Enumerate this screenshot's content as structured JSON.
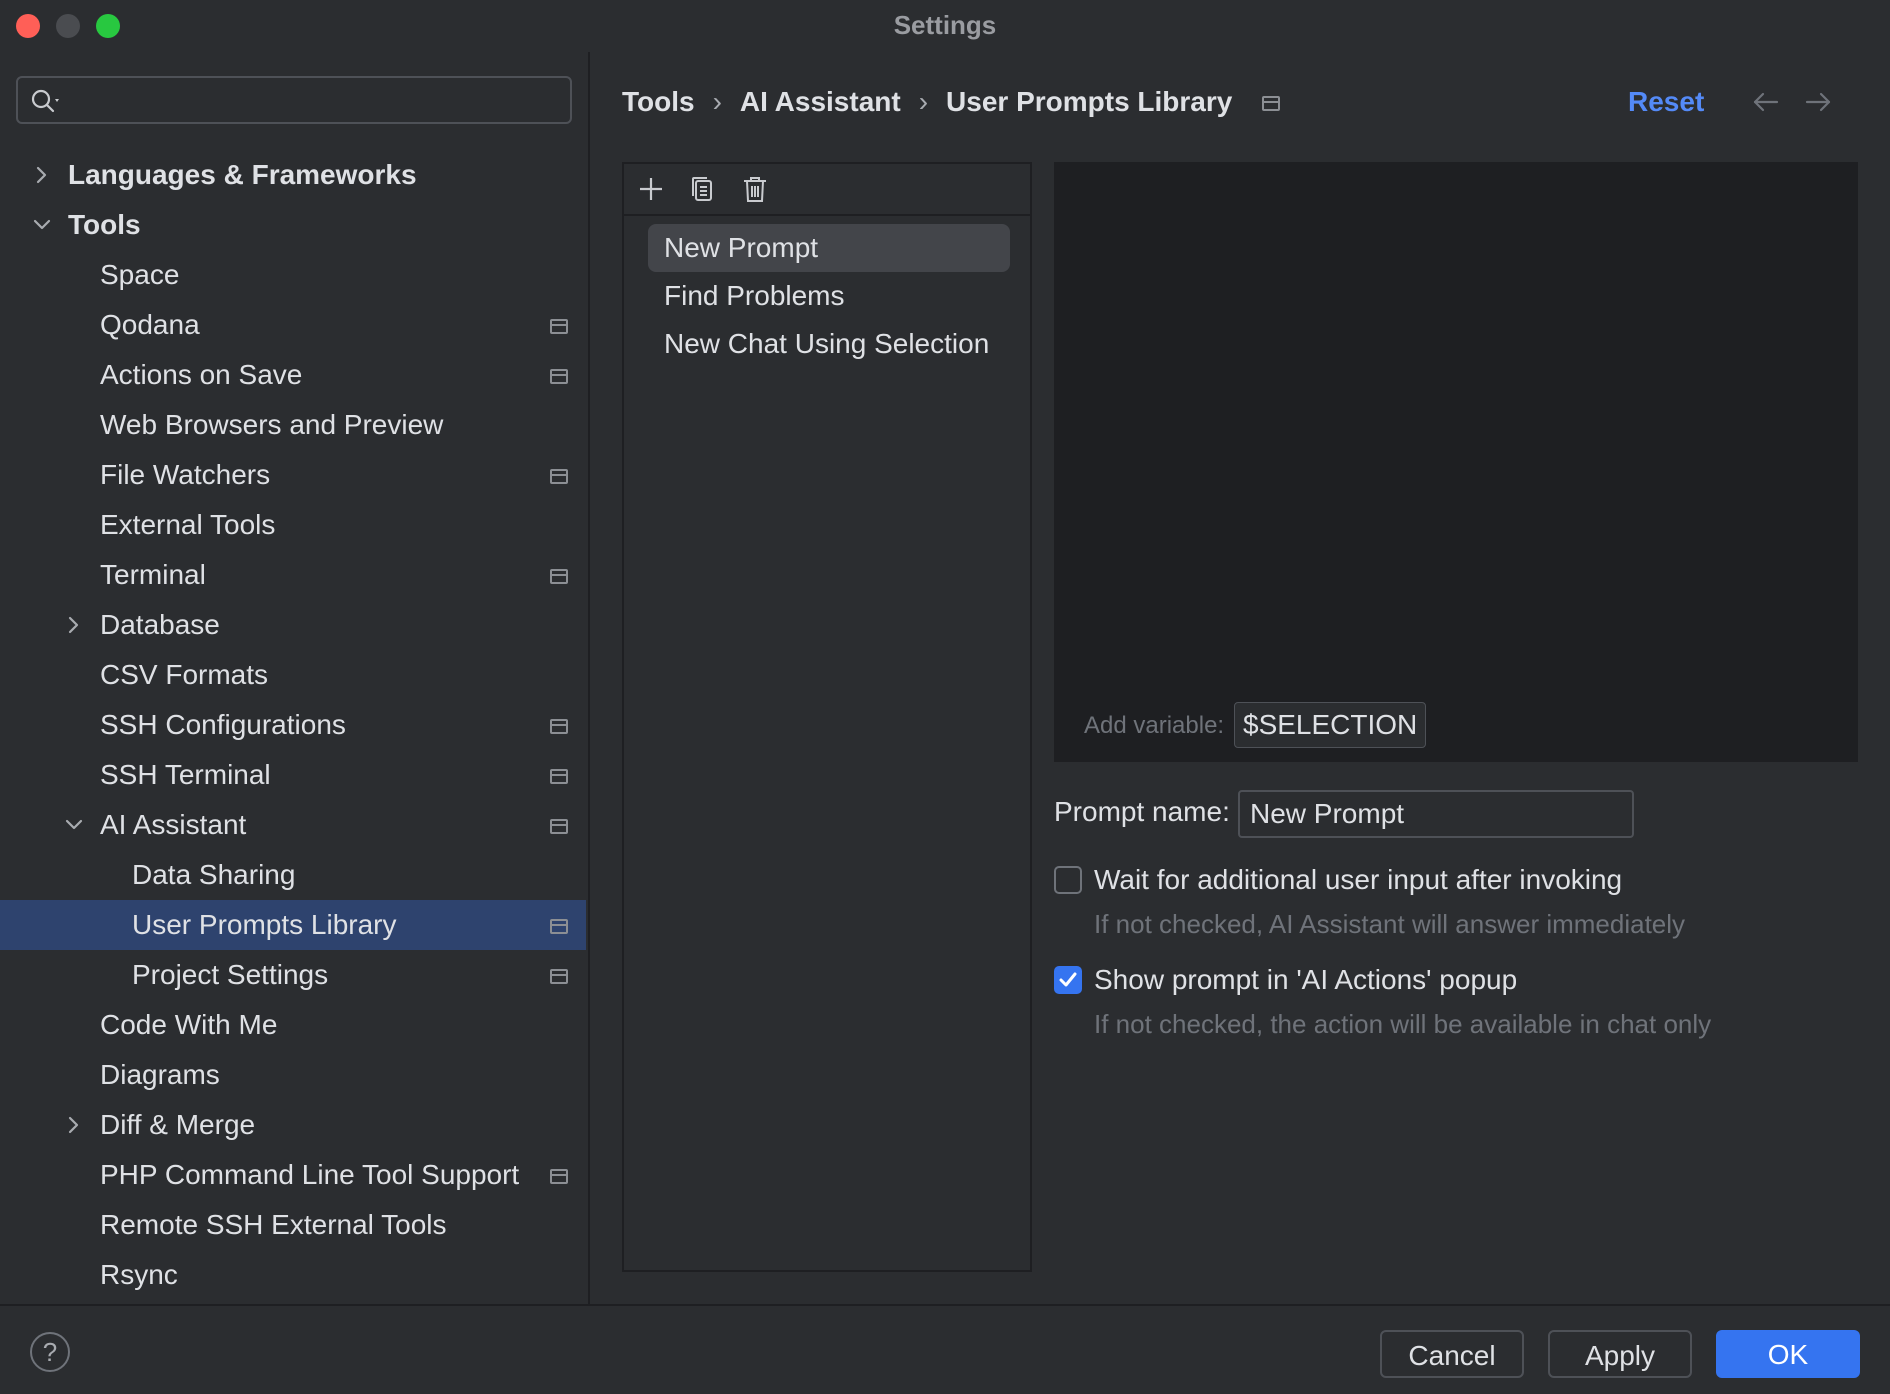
{
  "window": {
    "title": "Settings"
  },
  "search": {
    "placeholder": "",
    "value": ""
  },
  "sidebar": {
    "items": [
      {
        "label": "Languages & Frameworks",
        "bold": true,
        "indent": 0,
        "arrow": "right",
        "pinned": false,
        "selected": false
      },
      {
        "label": "Tools",
        "bold": true,
        "indent": 0,
        "arrow": "down",
        "pinned": false,
        "selected": false
      },
      {
        "label": "Space",
        "bold": false,
        "indent": 1,
        "arrow": "",
        "pinned": false,
        "selected": false
      },
      {
        "label": "Qodana",
        "bold": false,
        "indent": 1,
        "arrow": "",
        "pinned": true,
        "selected": false
      },
      {
        "label": "Actions on Save",
        "bold": false,
        "indent": 1,
        "arrow": "",
        "pinned": true,
        "selected": false
      },
      {
        "label": "Web Browsers and Preview",
        "bold": false,
        "indent": 1,
        "arrow": "",
        "pinned": false,
        "selected": false
      },
      {
        "label": "File Watchers",
        "bold": false,
        "indent": 1,
        "arrow": "",
        "pinned": true,
        "selected": false
      },
      {
        "label": "External Tools",
        "bold": false,
        "indent": 1,
        "arrow": "",
        "pinned": false,
        "selected": false
      },
      {
        "label": "Terminal",
        "bold": false,
        "indent": 1,
        "arrow": "",
        "pinned": true,
        "selected": false
      },
      {
        "label": "Database",
        "bold": false,
        "indent": 1,
        "arrow": "right",
        "pinned": false,
        "selected": false
      },
      {
        "label": "CSV Formats",
        "bold": false,
        "indent": 1,
        "arrow": "",
        "pinned": false,
        "selected": false
      },
      {
        "label": "SSH Configurations",
        "bold": false,
        "indent": 1,
        "arrow": "",
        "pinned": true,
        "selected": false
      },
      {
        "label": "SSH Terminal",
        "bold": false,
        "indent": 1,
        "arrow": "",
        "pinned": true,
        "selected": false
      },
      {
        "label": "AI Assistant",
        "bold": false,
        "indent": 1,
        "arrow": "down",
        "pinned": true,
        "selected": false
      },
      {
        "label": "Data Sharing",
        "bold": false,
        "indent": 2,
        "arrow": "",
        "pinned": false,
        "selected": false
      },
      {
        "label": "User Prompts Library",
        "bold": false,
        "indent": 2,
        "arrow": "",
        "pinned": true,
        "selected": true
      },
      {
        "label": "Project Settings",
        "bold": false,
        "indent": 2,
        "arrow": "",
        "pinned": true,
        "selected": false
      },
      {
        "label": "Code With Me",
        "bold": false,
        "indent": 1,
        "arrow": "",
        "pinned": false,
        "selected": false
      },
      {
        "label": "Diagrams",
        "bold": false,
        "indent": 1,
        "arrow": "",
        "pinned": false,
        "selected": false
      },
      {
        "label": "Diff & Merge",
        "bold": false,
        "indent": 1,
        "arrow": "right",
        "pinned": false,
        "selected": false
      },
      {
        "label": "PHP Command Line Tool Support",
        "bold": false,
        "indent": 1,
        "arrow": "",
        "pinned": true,
        "selected": false
      },
      {
        "label": "Remote SSH External Tools",
        "bold": false,
        "indent": 1,
        "arrow": "",
        "pinned": false,
        "selected": false
      },
      {
        "label": "Rsync",
        "bold": false,
        "indent": 1,
        "arrow": "",
        "pinned": false,
        "selected": false
      }
    ]
  },
  "header": {
    "breadcrumb": [
      "Tools",
      "AI Assistant",
      "User Prompts Library"
    ],
    "separator": "›",
    "reset_label": "Reset"
  },
  "prompts": {
    "items": [
      {
        "label": "New Prompt",
        "active": true
      },
      {
        "label": "Find Problems",
        "active": false
      },
      {
        "label": "New Chat Using Selection",
        "active": false
      }
    ]
  },
  "editor": {
    "add_variable_label": "Add variable:",
    "variable_chip": "$SELECTION"
  },
  "form": {
    "prompt_name_label": "Prompt name:",
    "prompt_name_value": "New Prompt",
    "wait_input": {
      "label": "Wait for additional user input after invoking",
      "hint": "If not checked, AI Assistant will answer immediately",
      "checked": false
    },
    "show_popup": {
      "label": "Show prompt in 'AI Actions' popup",
      "hint": "If not checked, the action will be available in chat only",
      "checked": true
    }
  },
  "footer": {
    "help_label": "?",
    "cancel_label": "Cancel",
    "apply_label": "Apply",
    "ok_label": "OK"
  },
  "colors": {
    "background": "#2b2d30",
    "editor_bg": "#1e1f22",
    "selection": "#2e436e",
    "accent": "#3574f0",
    "link": "#548af7"
  }
}
